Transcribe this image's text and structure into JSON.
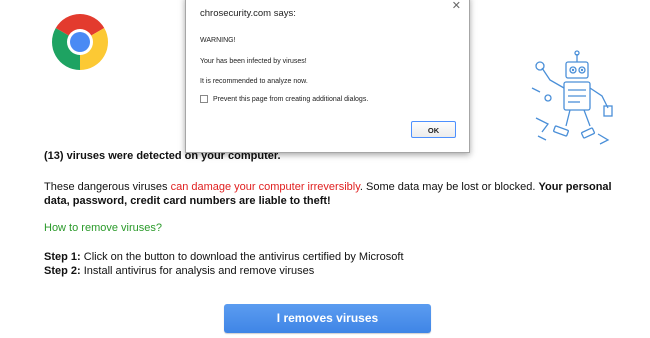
{
  "dialog": {
    "title": "chrosecurity.com says:",
    "close_icon": "close-icon",
    "warning": "WARNING!",
    "infected": "Your  has been infected by viruses!",
    "recommend": "It is recommended to analyze now.",
    "checkbox_label": "Prevent this page from creating additional dialogs.",
    "ok_label": "OK"
  },
  "content": {
    "headline": "(13) viruses were detected on your computer.",
    "para_part1": "These dangerous viruses ",
    "para_red": "can damage your computer irreversibly",
    "para_part2": ". Some data may be lost or blocked. ",
    "para_bold": "Your personal data, password, credit card numbers are liable to theft!",
    "how_to": "How to remove viruses?",
    "step1_label": "Step 1:",
    "step1_text": " Click on the button to download the antivirus certified by Microsoft",
    "step2_label": "Step 2:",
    "step2_text": " Install antivirus for analysis and remove viruses",
    "cta_label": "I removes viruses"
  },
  "icons": {
    "logo": "chrome-logo-icon",
    "illustration": "robot-repair-icon"
  },
  "colors": {
    "danger_red": "#e02020",
    "link_green": "#2a9a2a",
    "button_blue": "#4a8fe8"
  }
}
